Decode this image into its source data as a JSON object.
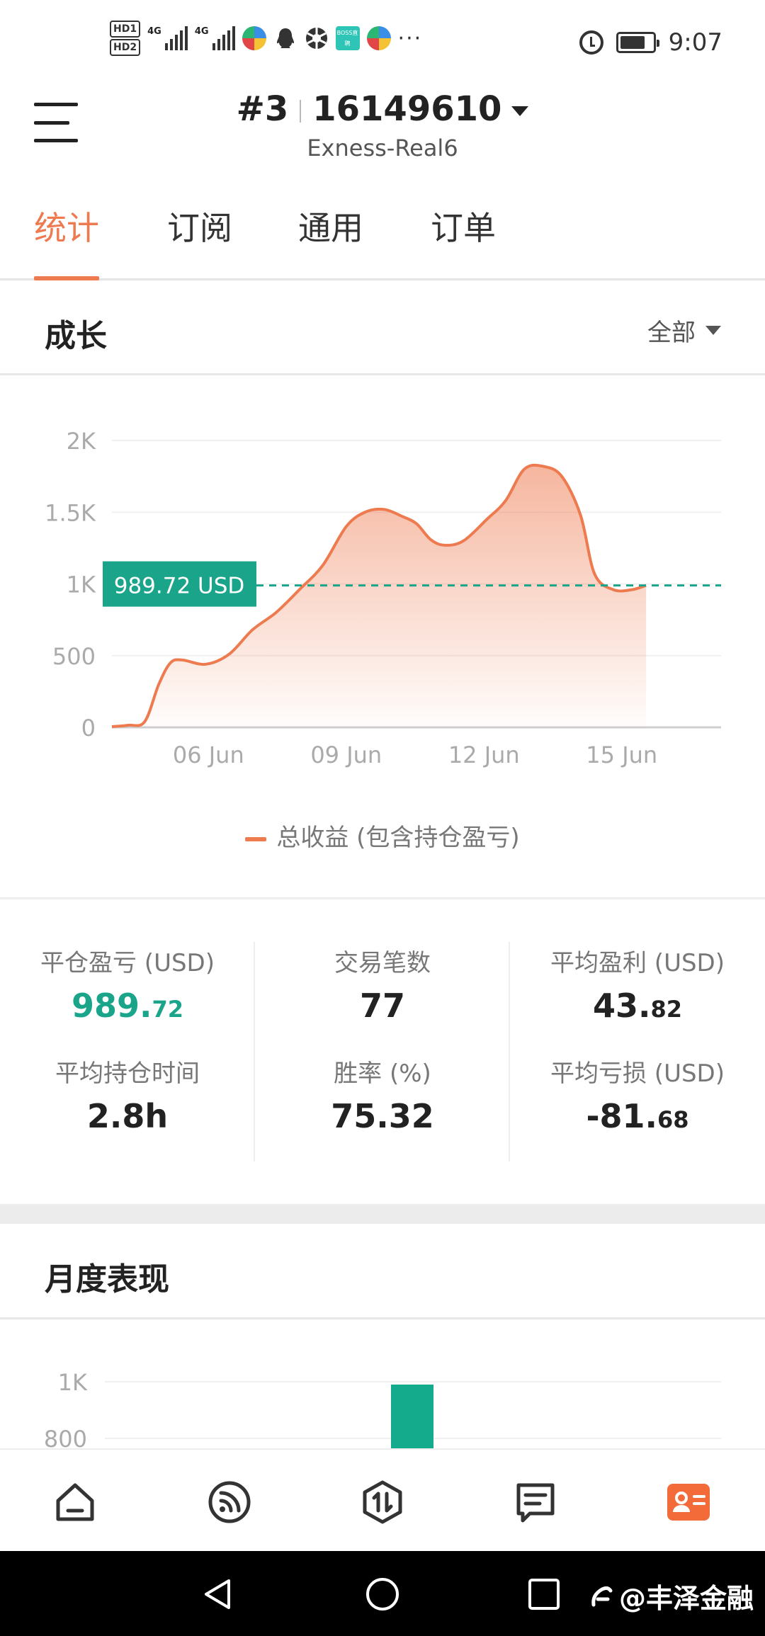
{
  "status_bar": {
    "hd1": "HD1",
    "hd2": "HD2",
    "net1": "4G",
    "net2": "4G",
    "boss_icon_text": "BOSS直聘",
    "more": "···",
    "time": "9:07",
    "icons": [
      "alarm-icon",
      "battery-icon"
    ]
  },
  "header": {
    "account_rank": "#3",
    "account_number": "16149610",
    "server": "Exness-Real6"
  },
  "tabs": [
    {
      "label": "统计",
      "active": true
    },
    {
      "label": "订阅",
      "active": false
    },
    {
      "label": "通用",
      "active": false
    },
    {
      "label": "订单",
      "active": false
    }
  ],
  "growth": {
    "title": "成长",
    "range_label": "全部",
    "current_value_label": "989.72 USD",
    "legend": "总收益 (包含持仓盈亏)"
  },
  "chart_data": [
    {
      "type": "area",
      "title": "",
      "xlabel": "",
      "ylabel": "",
      "y_ticks": [
        "0",
        "500",
        "1K",
        "1.5K",
        "2K"
      ],
      "ylim": [
        0,
        2000
      ],
      "x_ticks": [
        "06 Jun",
        "09 Jun",
        "12 Jun",
        "15 Jun"
      ],
      "series": [
        {
          "name": "总收益 (包含持仓盈亏)",
          "color": "#ee7a4f",
          "points": [
            [
              0,
              5
            ],
            [
              0.35,
              15
            ],
            [
              0.7,
              40
            ],
            [
              1.0,
              300
            ],
            [
              1.25,
              450
            ],
            [
              1.5,
              470
            ],
            [
              2.0,
              440
            ],
            [
              2.5,
              510
            ],
            [
              3.0,
              680
            ],
            [
              3.5,
              800
            ],
            [
              4.0,
              960
            ],
            [
              4.5,
              1130
            ],
            [
              5.0,
              1400
            ],
            [
              5.4,
              1500
            ],
            [
              5.8,
              1520
            ],
            [
              6.2,
              1470
            ],
            [
              6.5,
              1420
            ],
            [
              6.8,
              1310
            ],
            [
              7.1,
              1270
            ],
            [
              7.5,
              1300
            ],
            [
              8.0,
              1450
            ],
            [
              8.4,
              1580
            ],
            [
              8.8,
              1800
            ],
            [
              9.2,
              1820
            ],
            [
              9.6,
              1750
            ],
            [
              10.0,
              1480
            ],
            [
              10.3,
              1070
            ],
            [
              10.7,
              960
            ],
            [
              11.1,
              960
            ],
            [
              11.4,
              989.72
            ]
          ],
          "x_tick_positions": [
            3,
            6,
            9,
            12
          ]
        }
      ],
      "reference_line": {
        "value": 989.72,
        "label": "989.72 USD",
        "color": "#1aa58b"
      },
      "grid": true
    },
    {
      "type": "bar",
      "title": "",
      "y_ticks": [
        "800",
        "1K"
      ],
      "ylim": [
        0,
        1000
      ],
      "series": [
        {
          "color": "#14aa8c",
          "values": [
            990
          ]
        }
      ]
    }
  ],
  "stats": [
    {
      "label": "平仓盈亏 (USD)",
      "int": "989.",
      "dec": "72",
      "positive": true
    },
    {
      "label": "交易笔数",
      "int": "77",
      "dec": ""
    },
    {
      "label": "平均盈利 (USD)",
      "int": "43.",
      "dec": "82"
    },
    {
      "label": "平均持仓时间",
      "int": "2.8h",
      "dec": ""
    },
    {
      "label": "胜率 (%)",
      "int": "75.32",
      "dec": ""
    },
    {
      "label": "平均亏损 (USD)",
      "int": "-81.",
      "dec": "68"
    }
  ],
  "monthly": {
    "title": "月度表现"
  },
  "bottom_nav": [
    {
      "name": "home-icon",
      "active": false
    },
    {
      "name": "signal-feed-icon",
      "active": false
    },
    {
      "name": "trade-icon",
      "active": false
    },
    {
      "name": "news-icon",
      "active": false
    },
    {
      "name": "account-card-icon",
      "active": true
    }
  ],
  "colors": {
    "accent": "#ee7a4f",
    "positive": "#1aa58b",
    "text_primary": "#222222",
    "text_secondary": "#777777"
  },
  "watermark": "@丰泽金融"
}
